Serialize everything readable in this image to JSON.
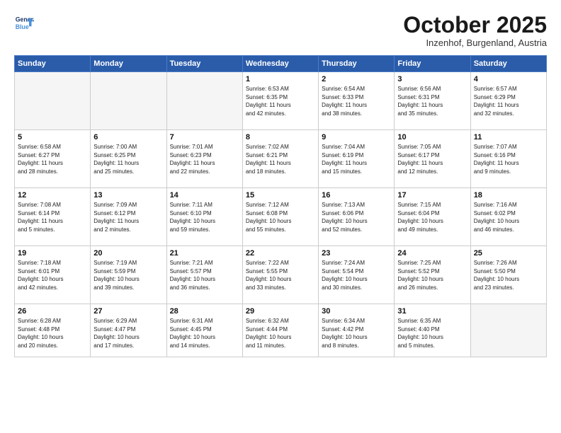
{
  "header": {
    "logo_line1": "General",
    "logo_line2": "Blue",
    "month": "October 2025",
    "location": "Inzenhof, Burgenland, Austria"
  },
  "days_of_week": [
    "Sunday",
    "Monday",
    "Tuesday",
    "Wednesday",
    "Thursday",
    "Friday",
    "Saturday"
  ],
  "weeks": [
    [
      {
        "day": "",
        "text": ""
      },
      {
        "day": "",
        "text": ""
      },
      {
        "day": "",
        "text": ""
      },
      {
        "day": "1",
        "text": "Sunrise: 6:53 AM\nSunset: 6:35 PM\nDaylight: 11 hours\nand 42 minutes."
      },
      {
        "day": "2",
        "text": "Sunrise: 6:54 AM\nSunset: 6:33 PM\nDaylight: 11 hours\nand 38 minutes."
      },
      {
        "day": "3",
        "text": "Sunrise: 6:56 AM\nSunset: 6:31 PM\nDaylight: 11 hours\nand 35 minutes."
      },
      {
        "day": "4",
        "text": "Sunrise: 6:57 AM\nSunset: 6:29 PM\nDaylight: 11 hours\nand 32 minutes."
      }
    ],
    [
      {
        "day": "5",
        "text": "Sunrise: 6:58 AM\nSunset: 6:27 PM\nDaylight: 11 hours\nand 28 minutes."
      },
      {
        "day": "6",
        "text": "Sunrise: 7:00 AM\nSunset: 6:25 PM\nDaylight: 11 hours\nand 25 minutes."
      },
      {
        "day": "7",
        "text": "Sunrise: 7:01 AM\nSunset: 6:23 PM\nDaylight: 11 hours\nand 22 minutes."
      },
      {
        "day": "8",
        "text": "Sunrise: 7:02 AM\nSunset: 6:21 PM\nDaylight: 11 hours\nand 18 minutes."
      },
      {
        "day": "9",
        "text": "Sunrise: 7:04 AM\nSunset: 6:19 PM\nDaylight: 11 hours\nand 15 minutes."
      },
      {
        "day": "10",
        "text": "Sunrise: 7:05 AM\nSunset: 6:17 PM\nDaylight: 11 hours\nand 12 minutes."
      },
      {
        "day": "11",
        "text": "Sunrise: 7:07 AM\nSunset: 6:16 PM\nDaylight: 11 hours\nand 9 minutes."
      }
    ],
    [
      {
        "day": "12",
        "text": "Sunrise: 7:08 AM\nSunset: 6:14 PM\nDaylight: 11 hours\nand 5 minutes."
      },
      {
        "day": "13",
        "text": "Sunrise: 7:09 AM\nSunset: 6:12 PM\nDaylight: 11 hours\nand 2 minutes."
      },
      {
        "day": "14",
        "text": "Sunrise: 7:11 AM\nSunset: 6:10 PM\nDaylight: 10 hours\nand 59 minutes."
      },
      {
        "day": "15",
        "text": "Sunrise: 7:12 AM\nSunset: 6:08 PM\nDaylight: 10 hours\nand 55 minutes."
      },
      {
        "day": "16",
        "text": "Sunrise: 7:13 AM\nSunset: 6:06 PM\nDaylight: 10 hours\nand 52 minutes."
      },
      {
        "day": "17",
        "text": "Sunrise: 7:15 AM\nSunset: 6:04 PM\nDaylight: 10 hours\nand 49 minutes."
      },
      {
        "day": "18",
        "text": "Sunrise: 7:16 AM\nSunset: 6:02 PM\nDaylight: 10 hours\nand 46 minutes."
      }
    ],
    [
      {
        "day": "19",
        "text": "Sunrise: 7:18 AM\nSunset: 6:01 PM\nDaylight: 10 hours\nand 42 minutes."
      },
      {
        "day": "20",
        "text": "Sunrise: 7:19 AM\nSunset: 5:59 PM\nDaylight: 10 hours\nand 39 minutes."
      },
      {
        "day": "21",
        "text": "Sunrise: 7:21 AM\nSunset: 5:57 PM\nDaylight: 10 hours\nand 36 minutes."
      },
      {
        "day": "22",
        "text": "Sunrise: 7:22 AM\nSunset: 5:55 PM\nDaylight: 10 hours\nand 33 minutes."
      },
      {
        "day": "23",
        "text": "Sunrise: 7:24 AM\nSunset: 5:54 PM\nDaylight: 10 hours\nand 30 minutes."
      },
      {
        "day": "24",
        "text": "Sunrise: 7:25 AM\nSunset: 5:52 PM\nDaylight: 10 hours\nand 26 minutes."
      },
      {
        "day": "25",
        "text": "Sunrise: 7:26 AM\nSunset: 5:50 PM\nDaylight: 10 hours\nand 23 minutes."
      }
    ],
    [
      {
        "day": "26",
        "text": "Sunrise: 6:28 AM\nSunset: 4:48 PM\nDaylight: 10 hours\nand 20 minutes."
      },
      {
        "day": "27",
        "text": "Sunrise: 6:29 AM\nSunset: 4:47 PM\nDaylight: 10 hours\nand 17 minutes."
      },
      {
        "day": "28",
        "text": "Sunrise: 6:31 AM\nSunset: 4:45 PM\nDaylight: 10 hours\nand 14 minutes."
      },
      {
        "day": "29",
        "text": "Sunrise: 6:32 AM\nSunset: 4:44 PM\nDaylight: 10 hours\nand 11 minutes."
      },
      {
        "day": "30",
        "text": "Sunrise: 6:34 AM\nSunset: 4:42 PM\nDaylight: 10 hours\nand 8 minutes."
      },
      {
        "day": "31",
        "text": "Sunrise: 6:35 AM\nSunset: 4:40 PM\nDaylight: 10 hours\nand 5 minutes."
      },
      {
        "day": "",
        "text": ""
      }
    ]
  ]
}
